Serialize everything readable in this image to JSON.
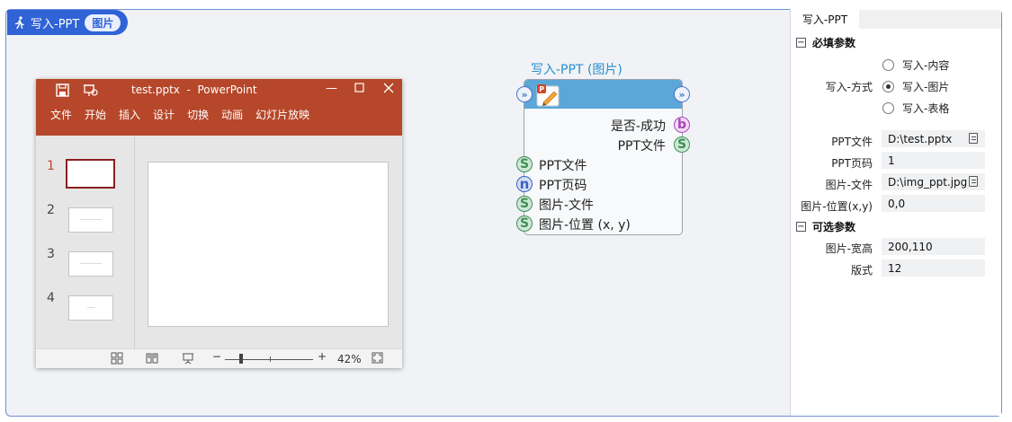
{
  "header": {
    "title": "写入-PPT",
    "badge": "图片"
  },
  "powerpoint": {
    "doc_title": "test.pptx  -  PowerPoint",
    "menu": [
      "文件",
      "开始",
      "插入",
      "设计",
      "切换",
      "动画",
      "幻灯片放映"
    ],
    "thumbnails": [
      "1",
      "2",
      "3",
      "4"
    ],
    "zoom_minus": "−",
    "zoom_plus": "+",
    "zoom": "42%",
    "accent": "#b7472a"
  },
  "node": {
    "title": "写入-PPT (图片)",
    "outputs": [
      {
        "label": "是否-成功",
        "type": "b"
      },
      {
        "label": "PPT文件",
        "type": "S"
      }
    ],
    "inputs": [
      {
        "label": "PPT文件",
        "type": "S"
      },
      {
        "label": "PPT页码",
        "type": "n"
      },
      {
        "label": "图片-文件",
        "type": "S"
      },
      {
        "label": "图片-位置 (x, y)",
        "type": "S"
      }
    ]
  },
  "panel": {
    "tab": "写入-PPT",
    "required_title": "必填参数",
    "write_mode_label": "写入-方式",
    "write_modes": [
      {
        "label": "写入-内容",
        "selected": false
      },
      {
        "label": "写入-图片",
        "selected": true
      },
      {
        "label": "写入-表格",
        "selected": false
      }
    ],
    "fields": [
      {
        "label": "PPT文件",
        "value": "D:\\test.pptx",
        "picker": true
      },
      {
        "label": "PPT页码",
        "value": "1",
        "picker": false
      },
      {
        "label": "图片-文件",
        "value": "D:\\img_ppt.jpg",
        "picker": true
      },
      {
        "label": "图片-位置(x,y)",
        "value": "0,0",
        "picker": false
      }
    ],
    "optional_title": "可选参数",
    "optional_fields": [
      {
        "label": "图片-宽高",
        "value": "200,110"
      },
      {
        "label": "版式",
        "value": "12"
      }
    ]
  }
}
